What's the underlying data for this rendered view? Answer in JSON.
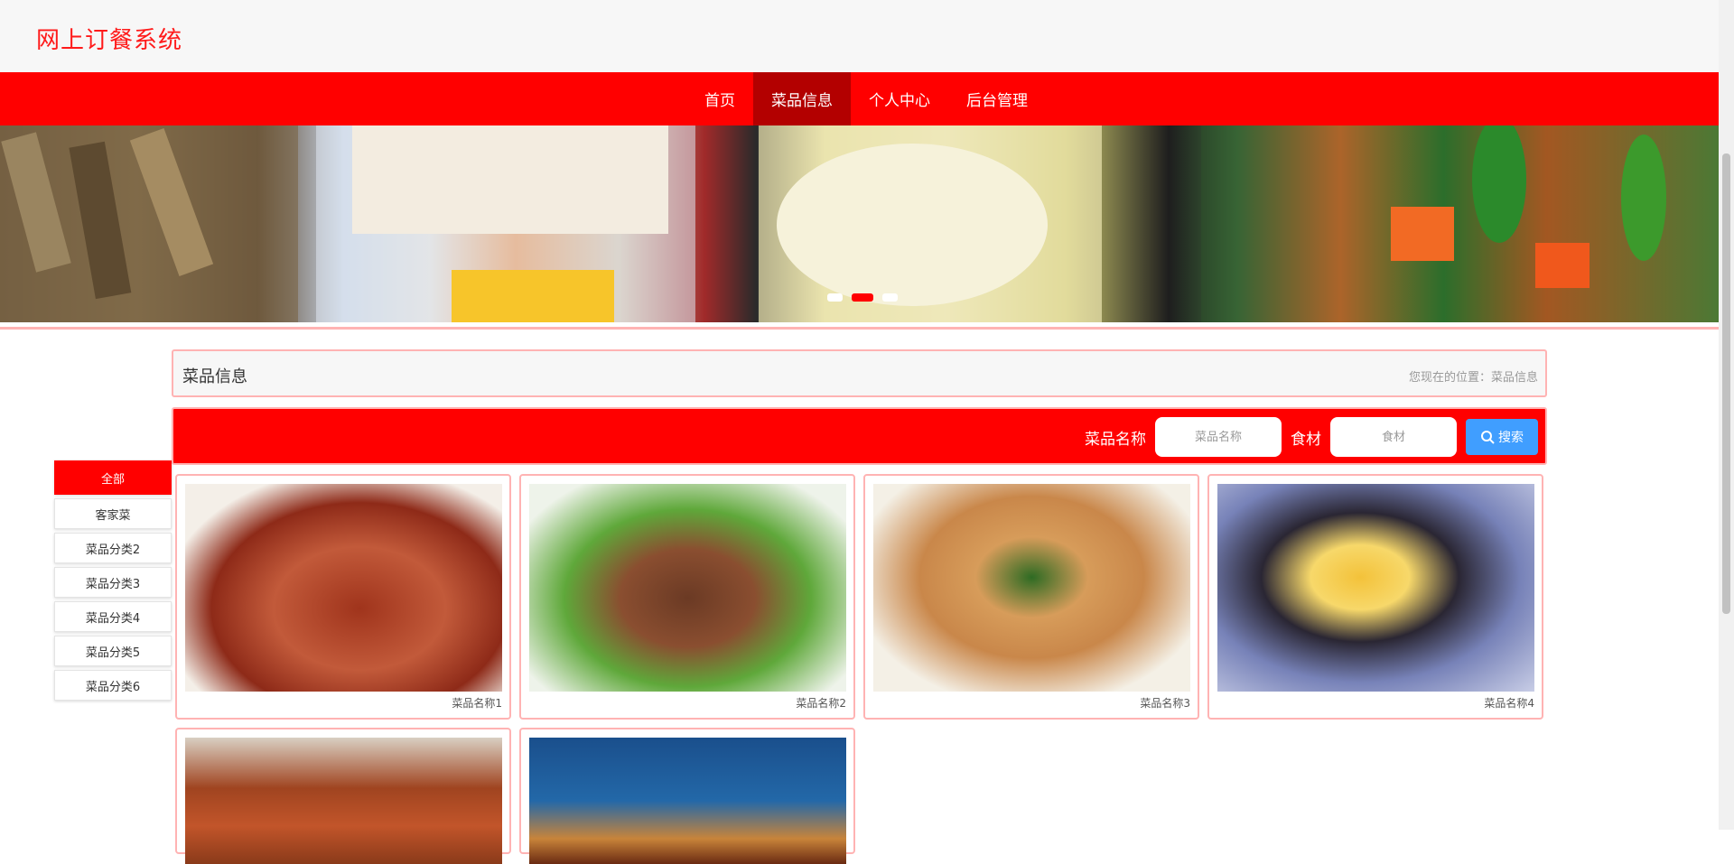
{
  "header": {
    "title": "网上订餐系统"
  },
  "nav": {
    "items": [
      {
        "label": "首页",
        "active": false
      },
      {
        "label": "菜品信息",
        "active": true
      },
      {
        "label": "个人中心",
        "active": false
      },
      {
        "label": "后台管理",
        "active": false
      }
    ]
  },
  "banner": {
    "dots": 3,
    "active_dot": 2
  },
  "breadcrumb": {
    "title": "菜品信息",
    "location": "您现在的位置：菜品信息"
  },
  "search": {
    "name_label": "菜品名称",
    "name_placeholder": "菜品名称",
    "ingredient_label": "食材",
    "ingredient_placeholder": "食材",
    "button_label": "搜索"
  },
  "sidebar": {
    "items": [
      {
        "label": "全部",
        "active": true
      },
      {
        "label": "客家菜",
        "active": false
      },
      {
        "label": "菜品分类2",
        "active": false
      },
      {
        "label": "菜品分类3",
        "active": false
      },
      {
        "label": "菜品分类4",
        "active": false
      },
      {
        "label": "菜品分类5",
        "active": false
      },
      {
        "label": "菜品分类6",
        "active": false
      }
    ]
  },
  "dishes": [
    {
      "name": "菜品名称1"
    },
    {
      "name": "菜品名称2"
    },
    {
      "name": "菜品名称3"
    },
    {
      "name": "菜品名称4"
    },
    {
      "name": ""
    },
    {
      "name": ""
    }
  ],
  "colors": {
    "primary": "#ff0000",
    "nav_active": "#b30000",
    "button": "#409eff"
  }
}
